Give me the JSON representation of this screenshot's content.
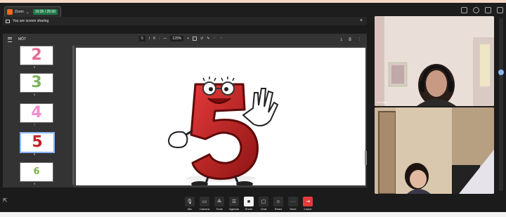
{
  "app": {
    "name": "Zoom",
    "timer": "19:35 / 25:00"
  },
  "banner": {
    "text": "You are screen sharing",
    "close": "×"
  },
  "pdf": {
    "title": "MỘT",
    "page_current": "5",
    "page_total": "6",
    "zoom": "125%",
    "thumbnails": [
      {
        "glyph": "2",
        "num": "5",
        "color": "#e86a8f"
      },
      {
        "glyph": "3",
        "num": "6",
        "color": "#7ab35b"
      },
      {
        "glyph": "4",
        "num": "7",
        "color": "#f08dd2"
      },
      {
        "glyph": "5",
        "num": "8",
        "color": "#c51f25"
      },
      {
        "glyph": "6",
        "num": "9",
        "color": "#79b347"
      }
    ]
  },
  "participants": [
    {
      "name": "Cô Hoa"
    },
    {
      "name": ""
    }
  ],
  "controls": [
    {
      "label": "Mic",
      "icon": "🎙"
    },
    {
      "label": "Camera",
      "icon": "▭"
    },
    {
      "label": "Tools",
      "icon": "⟁"
    },
    {
      "label": "Agenda",
      "icon": "☰"
    },
    {
      "label": "Share",
      "icon": "■"
    },
    {
      "label": "Chat",
      "icon": "▢"
    },
    {
      "label": "React",
      "icon": "☺"
    },
    {
      "label": "More",
      "icon": "···"
    },
    {
      "label": "Leave",
      "icon": "⇥"
    }
  ],
  "colors": {
    "accent": "#f56b1b",
    "leave": "#e53a3a",
    "selected": "#8ab4f8"
  }
}
